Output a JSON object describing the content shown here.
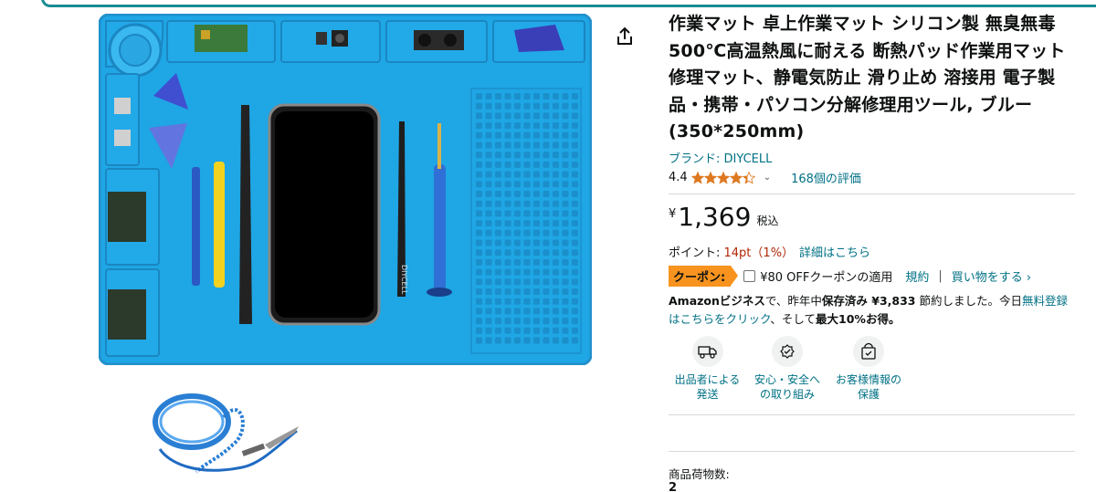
{
  "product": {
    "title": "作業マット 卓上作業マット シリコン製 無臭無毒 500℃高温熱風に耐える 断熱パッド作業用マット 修理マット、静電気防止 滑り止め 溶接用 電子製品・携帯・パソコン分解修理用ツール, ブルー (350*250mm)",
    "brand": "ブランド: DIYCELL",
    "rating_value": "4.4",
    "rating_stars": 4.4,
    "review_count": "168個の評価",
    "image_text": "DIYCELL"
  },
  "price": {
    "symbol": "¥",
    "whole": "1,369",
    "tax_label": "税込"
  },
  "points": {
    "prefix": "ポイント: ",
    "value": "14pt",
    "percent": "（1%）",
    "details_link": "詳細はこちら"
  },
  "coupon": {
    "badge": "クーポン:",
    "text": "¥80 OFFクーポンの適用",
    "terms": "規約",
    "separator": "|",
    "buy_link": "買い物をする ›"
  },
  "business": {
    "part1": "Amazonビジネス",
    "part2": "で、昨年中",
    "bold1": "保存済み ¥3,833",
    "part3": " 節約しました。今日",
    "link1": "無料登録はこちらをクリック",
    "part4": "、そして",
    "bold2": "最大10%お得。"
  },
  "features": [
    {
      "line1": "出品者による",
      "line2": "発送"
    },
    {
      "line1": "安心・安全へ",
      "line2": "の取り組み"
    },
    {
      "line1": "お客様情報の",
      "line2": "保護"
    }
  ],
  "quantity": {
    "label": "商品荷物数:",
    "value": "2"
  },
  "colors": {
    "link": "#007185",
    "price_red": "#b12704",
    "coupon_orange": "#f7931e",
    "mat_blue": "#1fa6e4",
    "star": "#de7921"
  }
}
